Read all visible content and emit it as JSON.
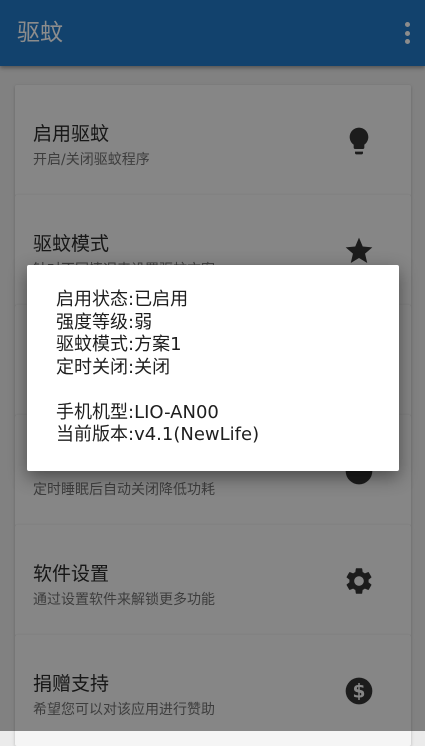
{
  "appbar": {
    "title": "驱蚊",
    "menu_icon": "more-vert-icon"
  },
  "cards": [
    {
      "title": "启用驱蚊",
      "subtitle": "开启/关闭驱蚊程序",
      "icon": "lightbulb-icon"
    },
    {
      "title": "驱蚊模式",
      "subtitle": "针对不同情况来设置驱蚊方案",
      "icon": "star-icon"
    },
    {
      "title": "",
      "subtitle": "",
      "icon": ""
    },
    {
      "title": "",
      "subtitle": "定时睡眠后自动关闭降低功耗",
      "icon": ""
    },
    {
      "title": "软件设置",
      "subtitle": "通过设置软件来解锁更多功能",
      "icon": "gear-icon"
    },
    {
      "title": "捐赠支持",
      "subtitle": "希望您可以对该应用进行赞助",
      "icon": "dollar-icon"
    }
  ],
  "dialog": {
    "status": "启用状态:已启用",
    "strength": "强度等级:弱",
    "mode": "驱蚊模式:方案1",
    "timer": "定时关闭:关闭",
    "model": "手机机型:LIO-AN00",
    "version": "当前版本:v4.1(NewLife)"
  },
  "colors": {
    "appbar": "#2178c6",
    "card": "#f5f5f5",
    "icon": "#333333"
  }
}
